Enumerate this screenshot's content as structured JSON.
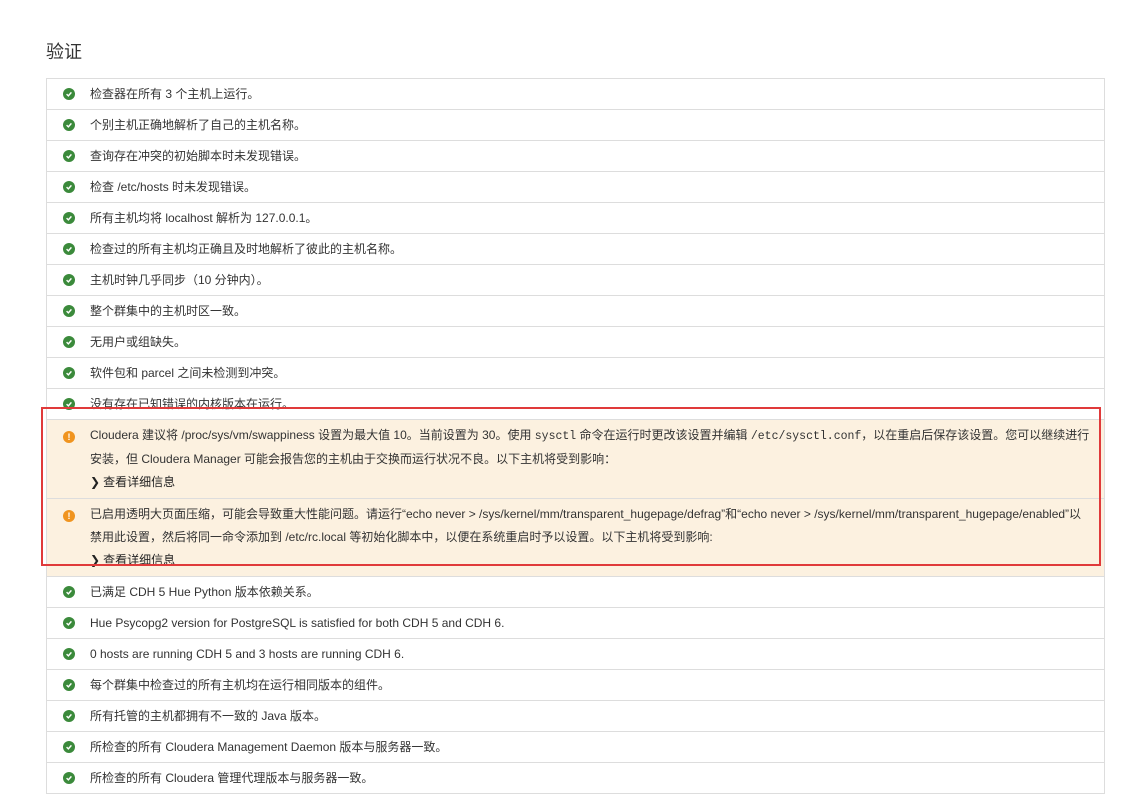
{
  "title": "验证",
  "colors": {
    "ok": "#3b8a3b",
    "warn": "#f0941f",
    "warn_bg": "#fcf1e0",
    "highlight": "#e03a3a"
  },
  "checks_before": [
    "检查器在所有 3 个主机上运行。",
    "个别主机正确地解析了自己的主机名称。",
    "查询存在冲突的初始脚本时未发现错误。",
    "检查 /etc/hosts 时未发现错误。",
    "所有主机均将 localhost 解析为 127.0.0.1。",
    "检查过的所有主机均正确且及时地解析了彼此的主机名称。",
    "主机时钟几乎同步（10 分钟内）。",
    "整个群集中的主机时区一致。",
    "无用户或组缺失。",
    "软件包和 parcel 之间未检测到冲突。",
    "没有存在已知错误的内核版本在运行。"
  ],
  "warnings": [
    {
      "parts": {
        "a": "Cloudera 建议将 /proc/sys/vm/swappiness 设置为最大值 10。当前设置为 30。使用 ",
        "code1": "sysctl",
        "b": " 命令在运行时更改该设置并编辑 ",
        "code2": "/etc/sysctl.conf",
        "c": "，以在重启后保存该设置。您可以继续进行安装，但 Cloudera Manager 可能会报告您的主机由于交换而运行状况不良。以下主机将受到影响："
      },
      "details_label": "查看详细信息"
    },
    {
      "text": "已启用透明大页面压缩，可能会导致重大性能问题。请运行“echo never > /sys/kernel/mm/transparent_hugepage/defrag”和“echo never > /sys/kernel/mm/transparent_hugepage/enabled”以禁用此设置，然后将同一命令添加到 /etc/rc.local 等初始化脚本中，以便在系统重启时予以设置。以下主机将受到影响:",
      "details_label": "查看详细信息"
    }
  ],
  "checks_after": [
    "已满足 CDH 5 Hue Python 版本依赖关系。",
    "Hue Psycopg2 version for PostgreSQL is satisfied for both CDH 5 and CDH 6.",
    "0 hosts are running CDH 5 and 3 hosts are running CDH 6.",
    "每个群集中检查过的所有主机均在运行相同版本的组件。",
    "所有托管的主机都拥有不一致的 Java 版本。",
    "所检查的所有 Cloudera Management Daemon 版本与服务器一致。",
    "所检查的所有 Cloudera 管理代理版本与服务器一致。"
  ]
}
